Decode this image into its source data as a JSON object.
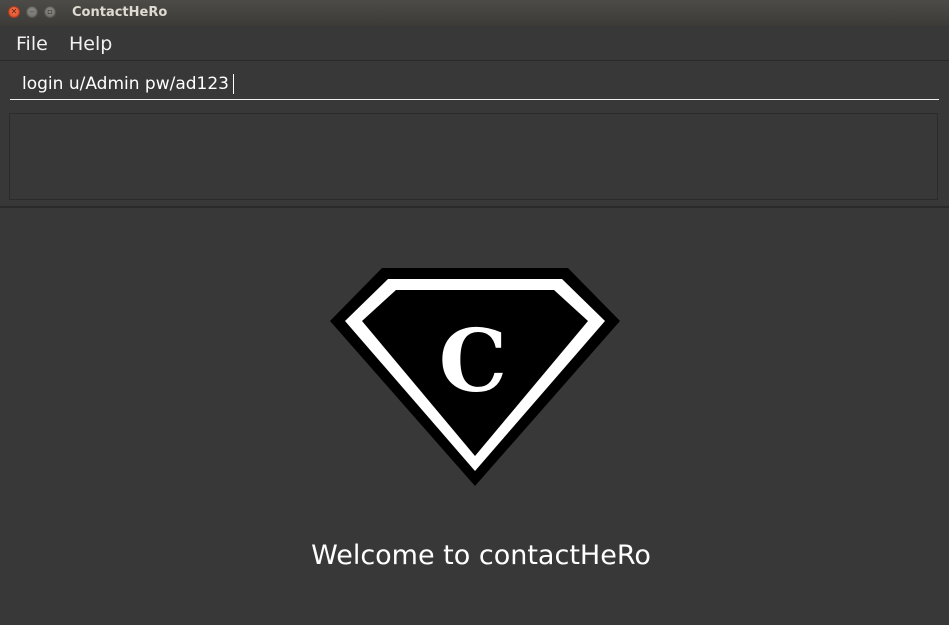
{
  "window": {
    "title": "ContactHeRo",
    "controls": [
      "close-icon",
      "minimize-icon",
      "maximize-icon"
    ]
  },
  "menu": {
    "file_label": "File",
    "help_label": "Help"
  },
  "command_box": {
    "value": "login u/Admin pw/ad123",
    "placeholder": ""
  },
  "result_display": {
    "text": ""
  },
  "welcome": {
    "logo_letter": "C",
    "logo_icon": "superhero-emblem-icon",
    "message": "Welcome to contactHeRo"
  },
  "colors": {
    "background": "#383838",
    "text": "#ffffff",
    "close_button": "#e25b35",
    "logo_black": "#000000",
    "logo_white": "#ffffff"
  }
}
